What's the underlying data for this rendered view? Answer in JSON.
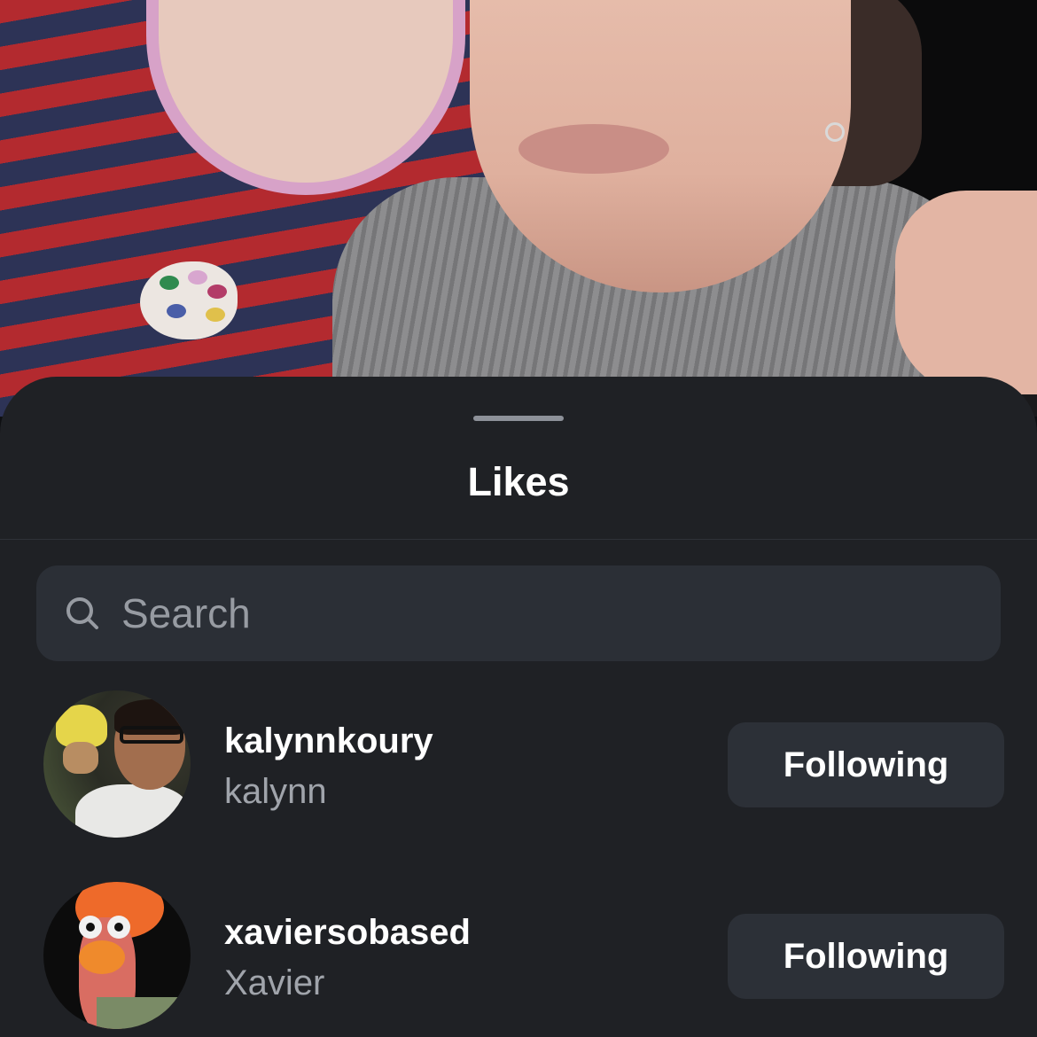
{
  "sheet": {
    "title": "Likes"
  },
  "search": {
    "placeholder": "Search",
    "icon": "search-icon"
  },
  "users": [
    {
      "username": "kalynnkoury",
      "full_name": "kalynn",
      "button_label": "Following"
    },
    {
      "username": "xaviersobased",
      "full_name": "Xavier",
      "button_label": "Following"
    }
  ],
  "colors": {
    "sheet_background": "#1f2125",
    "search_background": "#2b2f36",
    "button_background": "#2c3037",
    "primary_text": "#ffffff",
    "secondary_text": "#a0a4ab"
  }
}
